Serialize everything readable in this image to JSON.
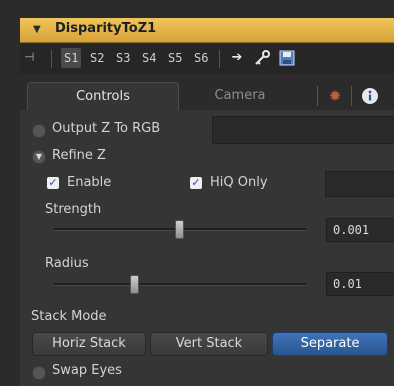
{
  "header": {
    "title": "DisparityToZ1"
  },
  "toolbar": {
    "slots": [
      "S1",
      "S2",
      "S3",
      "S4",
      "S5",
      "S6"
    ],
    "active_slot": "S1"
  },
  "tabs": [
    {
      "label": "Controls",
      "active": true
    },
    {
      "label": "Camera",
      "active": false
    }
  ],
  "controls": {
    "output_z_to_rgb": {
      "label": "Output Z To RGB",
      "checked": false
    },
    "refine_z": {
      "label": "Refine Z",
      "expanded": true
    },
    "enable": {
      "label": "Enable",
      "checked": true
    },
    "hiq_only": {
      "label": "HiQ Only",
      "checked": true
    },
    "strength": {
      "label": "Strength",
      "value": "0.001"
    },
    "radius": {
      "label": "Radius",
      "value": "0.01"
    },
    "stack_mode": {
      "label": "Stack Mode",
      "options": [
        "Horiz Stack",
        "Vert Stack",
        "Separate"
      ],
      "selected": "Separate"
    },
    "swap_eyes": {
      "label": "Swap Eyes",
      "checked": false
    }
  },
  "colors": {
    "header": "#e4b34a",
    "accent": "#3568a8",
    "panel": "#353535"
  },
  "icons": [
    "pin-icon",
    "arrow-right-icon",
    "key-icon",
    "save-icon",
    "gear-icon",
    "info-icon"
  ]
}
